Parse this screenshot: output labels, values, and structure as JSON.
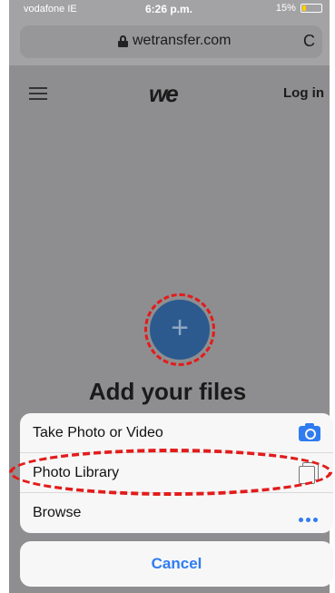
{
  "status_bar": {
    "carrier": "vodafone IE",
    "time": "6:26 p.m.",
    "battery": "15%"
  },
  "browser": {
    "url": "wetransfer.com",
    "reload_glyph": "C"
  },
  "site_header": {
    "logo": "we",
    "login_label": "Log in"
  },
  "main": {
    "add_glyph": "+",
    "title": "Add your files"
  },
  "action_sheet": {
    "items": [
      {
        "label": "Take Photo or Video",
        "icon": "camera-icon"
      },
      {
        "label": "Photo Library",
        "icon": "photo-library-icon"
      },
      {
        "label": "Browse",
        "icon": "more-icon"
      }
    ],
    "cancel_label": "Cancel"
  },
  "colors": {
    "accent": "#2f7cf0",
    "add_button": "#2c5a8e",
    "annotation": "#e31b1b",
    "overlay": "#8e8e90"
  }
}
